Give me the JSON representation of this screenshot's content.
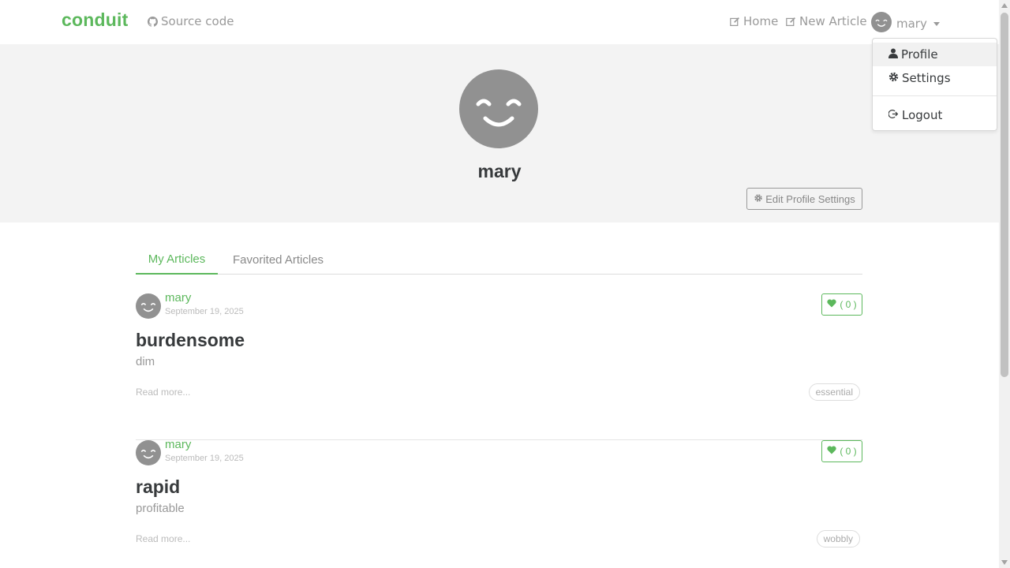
{
  "colors": {
    "brand": "#5cb85c",
    "banner_bg": "#f3f3f3",
    "avatar_bg": "#919191"
  },
  "nav": {
    "brand": "conduit",
    "source_code": "Source code",
    "home": "Home",
    "new_article": "New Article",
    "user": "mary",
    "icons": {
      "source": "github-icon",
      "home": "edit-icon",
      "new_article": "edit-icon",
      "user": "smiley-avatar"
    }
  },
  "dropdown": {
    "profile": "Profile",
    "settings": "Settings",
    "logout": "Logout",
    "icons": {
      "profile": "user-icon",
      "settings": "gear-icon",
      "logout": "logout-icon"
    }
  },
  "profile": {
    "username": "mary",
    "edit_button": "Edit Profile Settings"
  },
  "tabs": {
    "my_articles": "My Articles",
    "favorited_articles": "Favorited Articles",
    "active": "My Articles"
  },
  "articles": [
    {
      "author": "mary",
      "date": "September 19, 2025",
      "favorites": "( 0 )",
      "title": "burdensome",
      "description": "dim",
      "read_more": "Read more...",
      "tag": "essential"
    },
    {
      "author": "mary",
      "date": "September 19, 2025",
      "favorites": "( 0 )",
      "title": "rapid",
      "description": "profitable",
      "read_more": "Read more...",
      "tag": "wobbly"
    }
  ]
}
